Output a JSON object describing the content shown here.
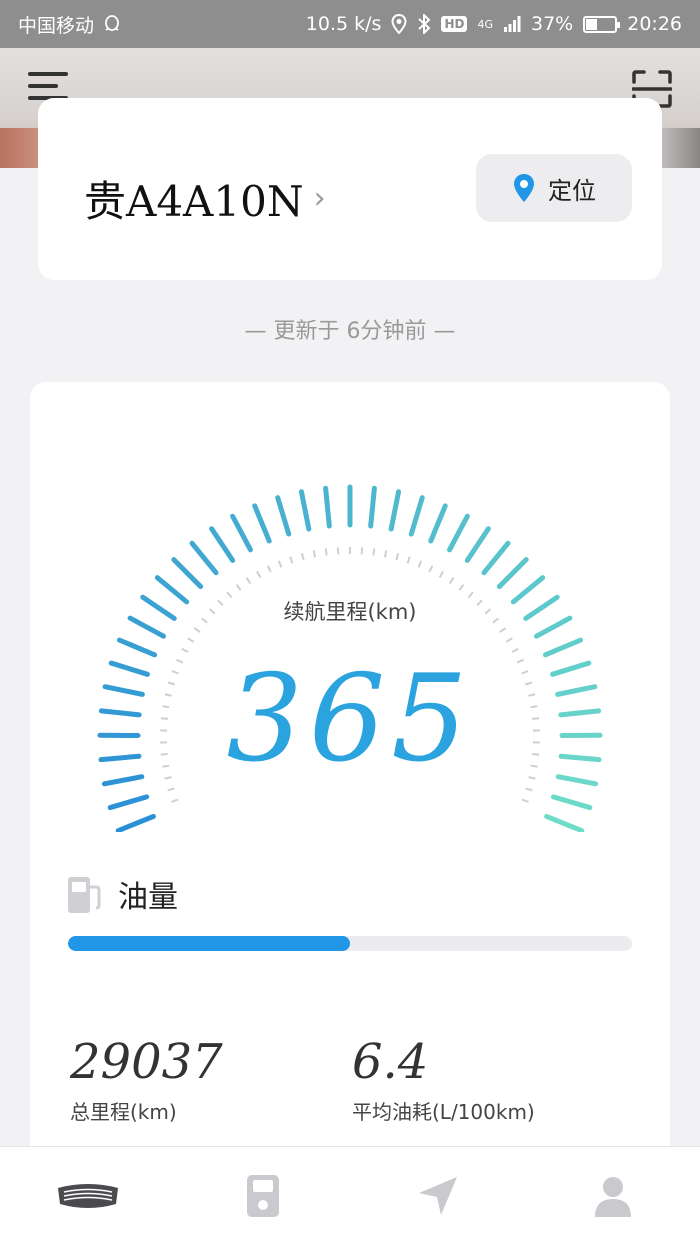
{
  "status_bar": {
    "carrier": "中国移动",
    "speed": "10.5 k/s",
    "network": "4G",
    "hd": "HD",
    "battery": "37%",
    "battery_level": 0.37,
    "time": "20:26"
  },
  "vehicle": {
    "plate": "贵A4A10N",
    "locate_label": "定位"
  },
  "update_text": "— 更新于 6分钟前 —",
  "range": {
    "label": "续航里程(km)",
    "value": "365"
  },
  "fuel": {
    "label": "油量",
    "level": 0.5
  },
  "stats": {
    "total_mileage": {
      "value": "29037",
      "label": "总里程(km)"
    },
    "avg_consumption": {
      "value": "6.4",
      "label": "平均油耗(L/100km)"
    }
  },
  "bottom_nav": {
    "items": [
      {
        "icon": "car-grille-icon",
        "active": true
      },
      {
        "icon": "car-key-icon",
        "active": false
      },
      {
        "icon": "navigation-arrow-icon",
        "active": false
      },
      {
        "icon": "user-icon",
        "active": false
      }
    ]
  },
  "colors": {
    "accent": "#2196e6",
    "gauge_start": "#2a8fd6",
    "gauge_end": "#6fdcc8",
    "range_value": "#2aa3df"
  }
}
